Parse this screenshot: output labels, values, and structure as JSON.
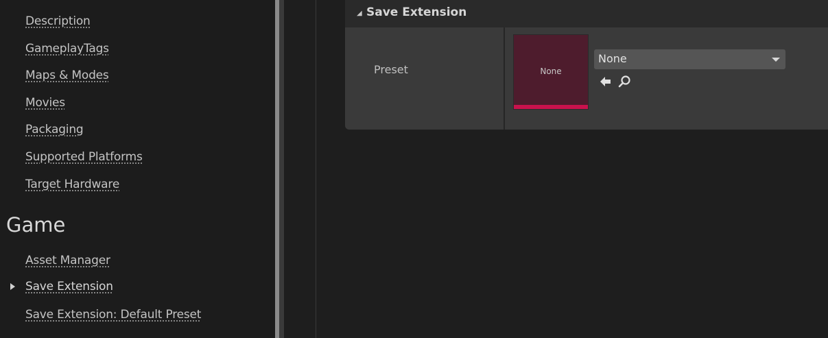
{
  "sidebar": {
    "top_links": [
      {
        "label": "Description"
      },
      {
        "label": "GameplayTags"
      },
      {
        "label": "Maps & Modes"
      },
      {
        "label": "Movies"
      },
      {
        "label": "Packaging"
      },
      {
        "label": "Supported Platforms"
      },
      {
        "label": "Target Hardware"
      }
    ],
    "section_heading": "Game",
    "game_links": [
      {
        "label": "Asset Manager"
      },
      {
        "label": "Save Extension",
        "selected": true
      },
      {
        "label": "Save Extension: Default Preset"
      }
    ]
  },
  "details": {
    "category_title": "Save Extension",
    "property": {
      "name": "Preset",
      "thumbnail_label": "None",
      "combo_value": "None",
      "browse_icon": "arrow-left-icon",
      "find_icon": "search-icon"
    }
  },
  "colors": {
    "accent": "#c9124d",
    "thumbnail_bg": "#4e1c2d"
  }
}
